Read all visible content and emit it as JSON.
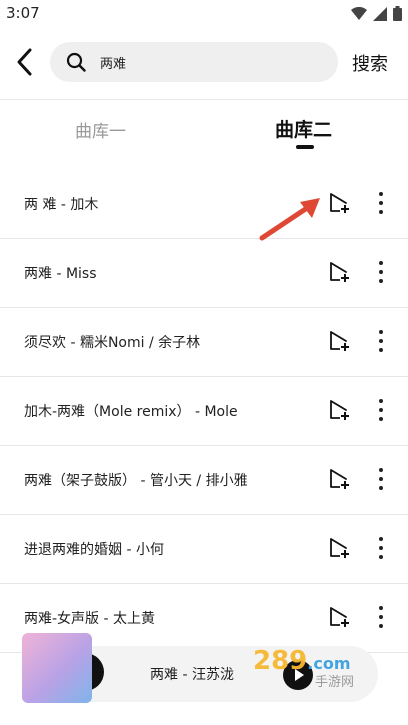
{
  "status": {
    "time": "3:07"
  },
  "header": {
    "search_value": "两难",
    "search_button": "搜索"
  },
  "tabs": [
    {
      "label": "曲库一"
    },
    {
      "label": "曲库二"
    }
  ],
  "songs": [
    {
      "title": "两 难 - 加木"
    },
    {
      "title": "两难 - Miss"
    },
    {
      "title": "须尽欢 - 糯米Nomi / 余子林"
    },
    {
      "title": "加木-两难（Mole remix） - Mole"
    },
    {
      "title": "两难（架子鼓版） - 管小天 / 排小雅"
    },
    {
      "title": "进退两难的婚姻 - 小何"
    },
    {
      "title": "两难-女声版 - 太上黄"
    }
  ],
  "player": {
    "now_playing": "两难 - 汪苏泷"
  },
  "watermark": {
    "brand": "289",
    "domain": ".com",
    "site": "手游网"
  },
  "icons": {
    "back": "back-arrow-icon",
    "search": "search-icon",
    "add": "add-to-playlist-icon",
    "more": "more-vertical-icon",
    "arrow": "red-arrow-annotation",
    "play": "play-icon"
  },
  "colors": {
    "accent": "#e04836",
    "tab_active": "#111111",
    "tab_inactive": "#999999"
  }
}
